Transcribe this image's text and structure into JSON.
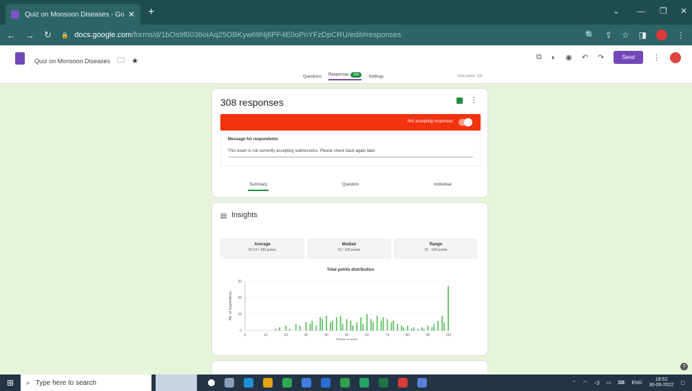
{
  "browser": {
    "tab_title": "Quiz on Monsoon Diseases - Go...",
    "new_tab": "+",
    "url_domain": "docs.google.com",
    "url_path": "/forms/d/1bOs9f0036oIAq25OBKyw69Nj6PF4E0oPnYFzDpCRU/edit#responses"
  },
  "form": {
    "title": "Quiz on Monsoon Diseases",
    "send_label": "Send",
    "tabs": [
      "Questions",
      "Responses",
      "Settings"
    ],
    "responses_badge": "308",
    "total_points": "Total points: 100"
  },
  "responses_card": {
    "title": "308 responses",
    "not_accepting_label": "Not accepting responses",
    "message_heading": "Message for respondents",
    "message_text": "This exam is not currently accepting submissions. Please check back again later.",
    "subtabs": [
      "Summary",
      "Question",
      "Individual"
    ]
  },
  "insights": {
    "title": "Insights",
    "stats": [
      {
        "label": "Average",
        "value": "62.14 / 100 points"
      },
      {
        "label": "Median",
        "value": "62 / 100 points"
      },
      {
        "label": "Range",
        "value": "15 - 100 points"
      }
    ]
  },
  "chart_data": {
    "type": "bar",
    "title": "Total points distribution",
    "xlabel": "Points scored",
    "ylabel": "No. of respondents",
    "xlim": [
      0,
      100
    ],
    "ylim": [
      0,
      30
    ],
    "xticks": [
      0,
      10,
      20,
      30,
      40,
      50,
      60,
      70,
      80,
      90,
      100
    ],
    "yticks": [
      0,
      10,
      20,
      30
    ],
    "x": [
      15,
      17,
      20,
      22,
      25,
      27,
      30,
      32,
      33,
      35,
      37,
      38,
      40,
      42,
      43,
      45,
      47,
      48,
      50,
      52,
      53,
      55,
      57,
      58,
      60,
      62,
      63,
      65,
      67,
      68,
      70,
      72,
      73,
      75,
      77,
      78,
      80,
      82,
      83,
      85,
      87,
      88,
      90,
      92,
      93,
      95,
      97,
      98,
      100
    ],
    "values": [
      1,
      2,
      3,
      1,
      4,
      3,
      5,
      4,
      6,
      3,
      8,
      7,
      9,
      5,
      6,
      8,
      9,
      4,
      7,
      6,
      3,
      5,
      8,
      4,
      10,
      7,
      5,
      9,
      6,
      8,
      7,
      5,
      6,
      4,
      3,
      2,
      3,
      1,
      2,
      1,
      2,
      1,
      3,
      2,
      4,
      6,
      9,
      5,
      27
    ]
  },
  "taskbar": {
    "search_placeholder": "Type here to search",
    "language": "ENG",
    "time": "18:52",
    "date": "30-06-2022"
  }
}
